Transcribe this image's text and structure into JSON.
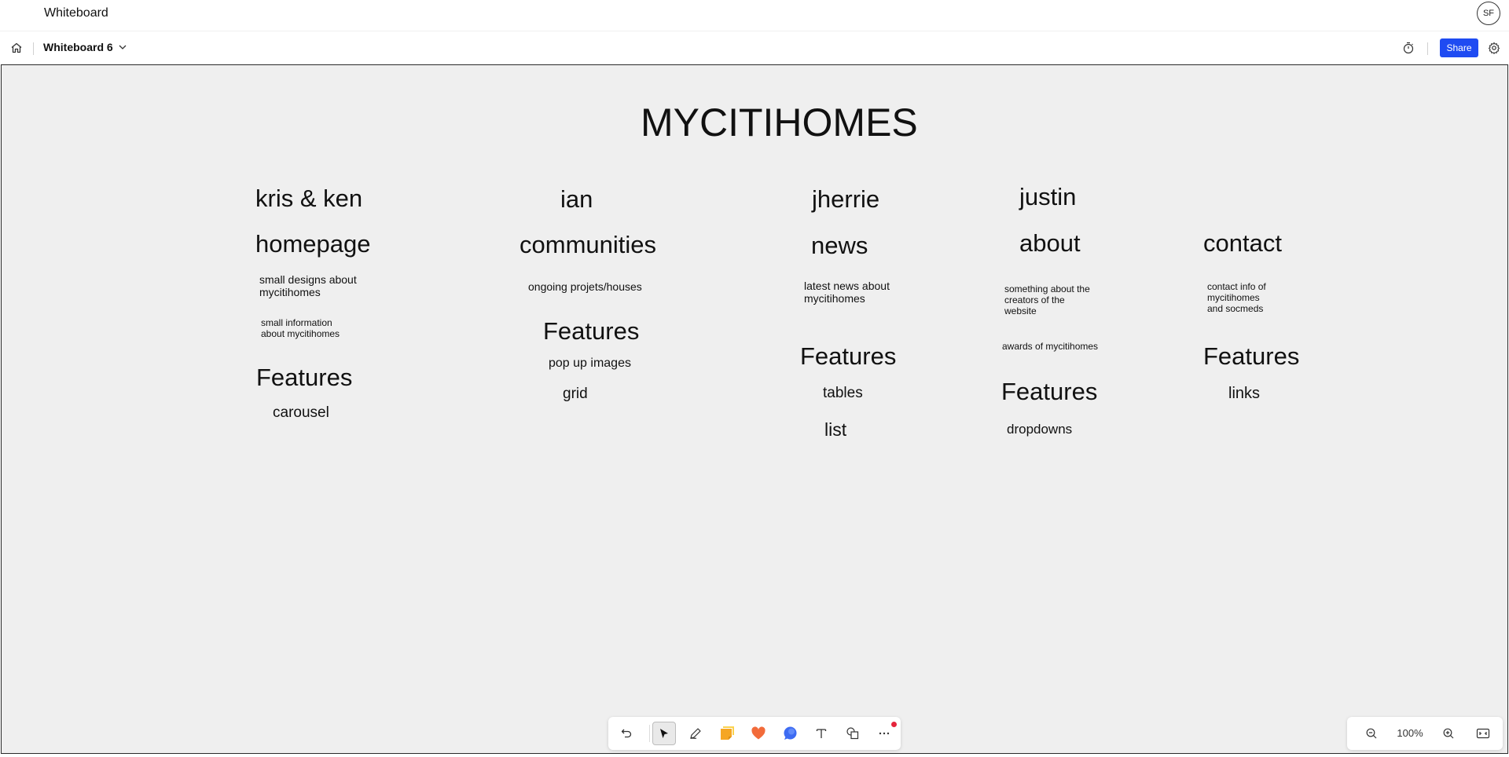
{
  "app": {
    "title": "Whiteboard",
    "avatar_initials": "SF"
  },
  "toolbar": {
    "board_name": "Whiteboard 6",
    "share_label": "Share"
  },
  "canvas": {
    "title": "MYCITIHOMES",
    "columns": [
      {
        "owner": "kris & ken",
        "page": "homepage",
        "notes": [
          "small designs about\nmycitihomes",
          "small information\nabout mycitihomes"
        ],
        "features_heading": "Features",
        "features": [
          "carousel"
        ]
      },
      {
        "owner": "ian",
        "page": "communities",
        "notes": [
          "ongoing projets/houses"
        ],
        "features_heading": "Features",
        "features": [
          "pop up images",
          "grid"
        ]
      },
      {
        "owner": "jherrie",
        "page": "news",
        "notes": [
          "latest news about\nmycitihomes"
        ],
        "features_heading": "Features",
        "features": [
          "tables",
          "list"
        ]
      },
      {
        "owner": "justin",
        "page": "about",
        "notes": [
          "something about the\ncreators of the\nwebsite",
          "awards of mycitihomes"
        ],
        "features_heading": "Features",
        "features": [
          "dropdowns"
        ]
      },
      {
        "owner": "",
        "page": "contact",
        "notes": [
          "contact info of\nmycitihomes\nand socmeds"
        ],
        "features_heading": "Features",
        "features": [
          "links"
        ]
      }
    ]
  },
  "zoom": {
    "level": "100%"
  },
  "colors": {
    "accent": "#1f4bf2",
    "canvas_bg": "#efefef",
    "notification_dot": "#e5243b"
  },
  "icons": {
    "dock": [
      "undo-icon",
      "select-pointer-icon",
      "pen-icon",
      "sticky-note-icon",
      "reaction-heart-icon",
      "comment-icon",
      "text-icon",
      "shapes-icon",
      "more-icon"
    ],
    "zoom": [
      "zoom-out-icon",
      "zoom-in-icon",
      "fit-to-screen-icon"
    ]
  }
}
